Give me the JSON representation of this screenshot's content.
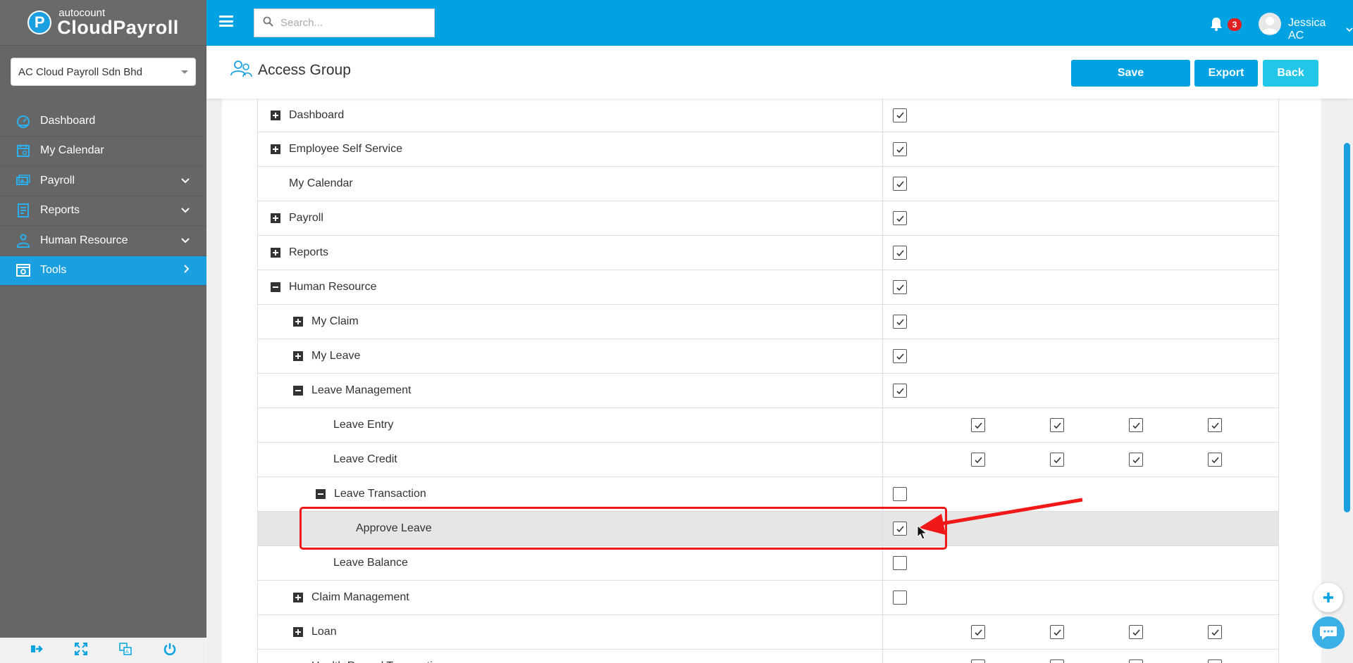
{
  "brand": {
    "small": "autocount",
    "big": "CloudPayroll",
    "badge": "P"
  },
  "company": {
    "selected": "AC Cloud Payroll Sdn Bhd"
  },
  "nav": [
    {
      "label": "Dashboard",
      "icon": "dashboard-icon",
      "chevron": ""
    },
    {
      "label": "My Calendar",
      "icon": "calendar-icon",
      "chevron": ""
    },
    {
      "label": "Payroll",
      "icon": "payroll-icon",
      "chevron": "down"
    },
    {
      "label": "Reports",
      "icon": "reports-icon",
      "chevron": "down"
    },
    {
      "label": "Human Resource",
      "icon": "human-resource-icon",
      "chevron": "down"
    },
    {
      "label": "Tools",
      "icon": "tools-icon",
      "chevron": "right",
      "active": true
    }
  ],
  "topbar": {
    "search_placeholder": "Search...",
    "notification_count": "3",
    "username": "Jessica AC"
  },
  "header": {
    "title": "Access Group",
    "save_label": "Save",
    "export_label": "Export",
    "back_label": "Back"
  },
  "colors": {
    "primary": "#00a2e2",
    "sidebar": "#666666",
    "accent_back": "#22c6e6",
    "highlight": "#f01818"
  },
  "rows": [
    {
      "label": "Dashboard",
      "level": 0,
      "expander": "plus",
      "checks": [
        true
      ]
    },
    {
      "label": "Employee Self Service",
      "level": 0,
      "expander": "plus",
      "checks": [
        true
      ]
    },
    {
      "label": "My Calendar",
      "level": 0,
      "expander": "",
      "checks": [
        true
      ]
    },
    {
      "label": "Payroll",
      "level": 0,
      "expander": "plus",
      "checks": [
        true
      ]
    },
    {
      "label": "Reports",
      "level": 0,
      "expander": "plus",
      "checks": [
        true
      ]
    },
    {
      "label": "Human Resource",
      "level": 0,
      "expander": "minus",
      "checks": [
        true
      ]
    },
    {
      "label": "My Claim",
      "level": 1,
      "expander": "plus",
      "checks": [
        true
      ]
    },
    {
      "label": "My Leave",
      "level": 1,
      "expander": "plus",
      "checks": [
        true
      ]
    },
    {
      "label": "Leave Management",
      "level": 1,
      "expander": "minus",
      "checks": [
        true
      ]
    },
    {
      "label": "Leave Entry",
      "level": 2,
      "expander": "",
      "checks": [
        null,
        true,
        true,
        true,
        true
      ]
    },
    {
      "label": "Leave Credit",
      "level": 2,
      "expander": "",
      "checks": [
        null,
        true,
        true,
        true,
        true
      ]
    },
    {
      "label": "Leave Transaction",
      "level": 2,
      "expander": "minus",
      "checks": [
        false
      ]
    },
    {
      "label": "Approve Leave",
      "level": 3,
      "expander": "",
      "checks": [
        true
      ],
      "highlight": true
    },
    {
      "label": "Leave Balance",
      "level": 2,
      "expander": "",
      "checks": [
        false
      ]
    },
    {
      "label": "Claim Management",
      "level": 1,
      "expander": "plus",
      "checks": [
        false
      ]
    },
    {
      "label": "Loan",
      "level": 1,
      "expander": "plus",
      "checks": [
        null,
        true,
        true,
        true,
        true
      ]
    },
    {
      "label": "Health Record Transaction",
      "level": 1,
      "expander": "",
      "checks": [
        null,
        false,
        false,
        false,
        false
      ]
    }
  ]
}
